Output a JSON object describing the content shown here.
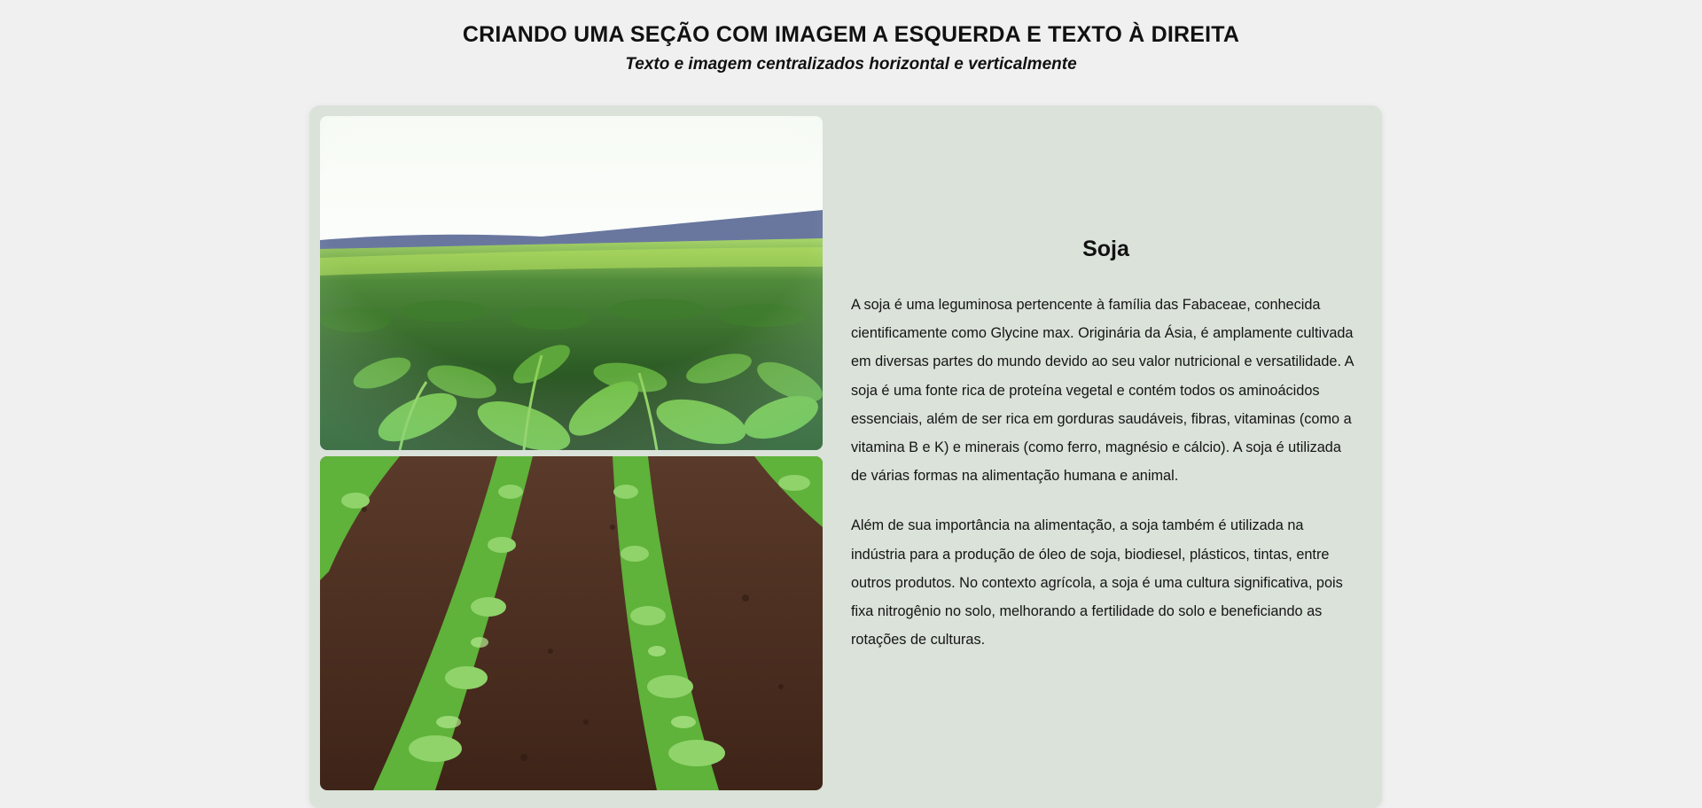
{
  "header": {
    "title": "CRIANDO UMA SEÇÃO COM IMAGEM A ESQUERDA E TEXTO À DIREITA",
    "subtitle": "Texto e imagem centralizados horizontal e verticalmente"
  },
  "section": {
    "heading": "Soja",
    "paragraphs": [
      "A soja é uma leguminosa pertencente à família das Fabaceae, conhecida cientificamente como Glycine max. Originária da Ásia, é amplamente cultivada em diversas partes do mundo devido ao seu valor nutricional e versatilidade. A soja é uma fonte rica de proteína vegetal e contém todos os aminoácidos essenciais, além de ser rica em gorduras saudáveis, fibras, vitaminas (como a vitamina B e K) e minerais (como ferro, magnésio e cálcio). A soja é utilizada de várias formas na alimentação humana e animal.",
      "Além de sua importância na alimentação, a soja também é utilizada na indústria para a produção de óleo de soja, biodiesel, plásticos, tintas, entre outros produtos. No contexto agrícola, a soja é uma cultura significativa, pois fixa nitrogênio no solo, melhorando a fertilidade do solo e beneficiando as rotações de culturas."
    ]
  },
  "colors": {
    "page_background": "#f0f0f0",
    "card_background": "#dae2d9",
    "plant_green": "#4c9a2a",
    "soil_brown": "#4a2b1f"
  },
  "images": [
    {
      "icon": "soybean-field-photo"
    },
    {
      "icon": "soybean-rows-photo"
    }
  ]
}
